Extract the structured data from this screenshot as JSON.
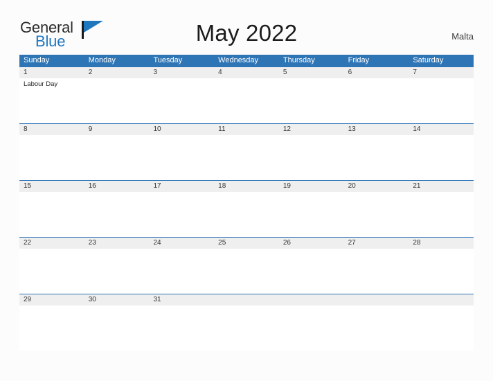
{
  "logo": {
    "word_one": "General",
    "word_two": "Blue",
    "flag_icon": "blue-flag-icon",
    "brand_color": "#1f77be"
  },
  "header": {
    "title": "May 2022",
    "locale": "Malta"
  },
  "calendar": {
    "header_color": "#2e75b6",
    "date_band_color": "#efefef",
    "weekdays": [
      "Sunday",
      "Monday",
      "Tuesday",
      "Wednesday",
      "Thursday",
      "Friday",
      "Saturday"
    ],
    "weeks": [
      {
        "days": [
          {
            "date": "1",
            "events": [
              "Labour Day"
            ]
          },
          {
            "date": "2",
            "events": []
          },
          {
            "date": "3",
            "events": []
          },
          {
            "date": "4",
            "events": []
          },
          {
            "date": "5",
            "events": []
          },
          {
            "date": "6",
            "events": []
          },
          {
            "date": "7",
            "events": []
          }
        ]
      },
      {
        "days": [
          {
            "date": "8",
            "events": []
          },
          {
            "date": "9",
            "events": []
          },
          {
            "date": "10",
            "events": []
          },
          {
            "date": "11",
            "events": []
          },
          {
            "date": "12",
            "events": []
          },
          {
            "date": "13",
            "events": []
          },
          {
            "date": "14",
            "events": []
          }
        ]
      },
      {
        "days": [
          {
            "date": "15",
            "events": []
          },
          {
            "date": "16",
            "events": []
          },
          {
            "date": "17",
            "events": []
          },
          {
            "date": "18",
            "events": []
          },
          {
            "date": "19",
            "events": []
          },
          {
            "date": "20",
            "events": []
          },
          {
            "date": "21",
            "events": []
          }
        ]
      },
      {
        "days": [
          {
            "date": "22",
            "events": []
          },
          {
            "date": "23",
            "events": []
          },
          {
            "date": "24",
            "events": []
          },
          {
            "date": "25",
            "events": []
          },
          {
            "date": "26",
            "events": []
          },
          {
            "date": "27",
            "events": []
          },
          {
            "date": "28",
            "events": []
          }
        ]
      },
      {
        "days": [
          {
            "date": "29",
            "events": []
          },
          {
            "date": "30",
            "events": []
          },
          {
            "date": "31",
            "events": []
          },
          {
            "date": "",
            "events": []
          },
          {
            "date": "",
            "events": []
          },
          {
            "date": "",
            "events": []
          },
          {
            "date": "",
            "events": []
          }
        ]
      }
    ]
  }
}
